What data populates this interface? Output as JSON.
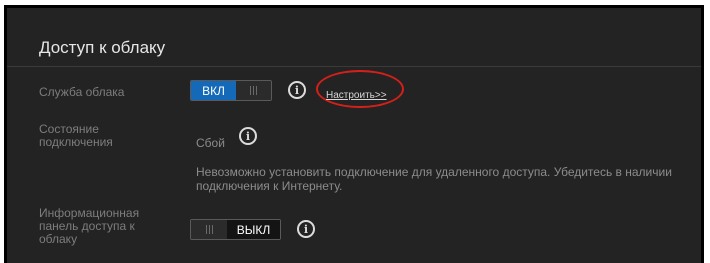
{
  "section": {
    "title": "Доступ к облаку"
  },
  "cloud_service": {
    "label": "Служба облака",
    "toggle_on_label": "ВКЛ",
    "configure_link": "Настроить>>",
    "info_icon": "info-icon"
  },
  "connection_status": {
    "label": "Состояние подключения",
    "value": "Сбой",
    "message": "Невозможно установить подключение для удаленного доступа. Убедитесь в наличии подключения к Интернету."
  },
  "dashboard": {
    "label": "Информационная панель доступа к облаку",
    "toggle_off_label": "ВЫКЛ"
  },
  "colors": {
    "panel_bg": "#232323",
    "accent_on": "#1469b8",
    "annotation_ring": "#d4201a"
  }
}
